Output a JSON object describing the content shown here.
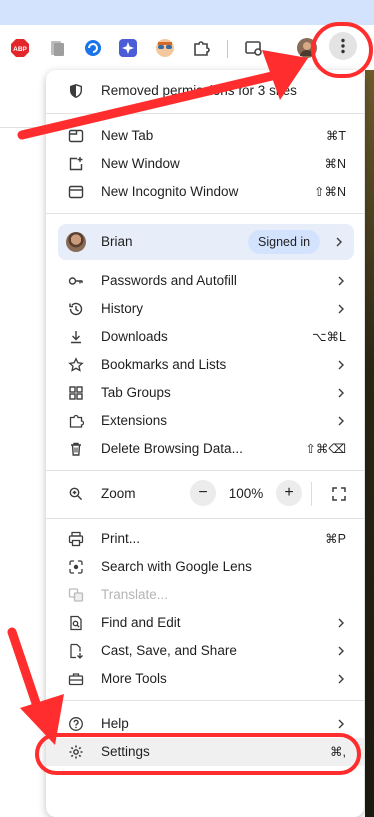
{
  "toolbar": {
    "extensions": [
      "adblock-plus-icon",
      "document-icon",
      "sync-icon",
      "sparkle-icon",
      "avatar-extension-icon",
      "puzzle-icon",
      "tab-search-icon"
    ],
    "abp_label": "ABP"
  },
  "menu": {
    "notice": "Removed permissions for 3 sites",
    "items_group1": [
      {
        "label": "New Tab",
        "shortcut": "⌘T"
      },
      {
        "label": "New Window",
        "shortcut": "⌘N"
      },
      {
        "label": "New Incognito Window",
        "shortcut": "⇧⌘N"
      }
    ],
    "profile": {
      "name": "Brian",
      "status": "Signed in"
    },
    "items_group2": [
      {
        "label": "Passwords and Autofill",
        "shortcut": ""
      },
      {
        "label": "History",
        "shortcut": ""
      },
      {
        "label": "Downloads",
        "shortcut": "⌥⌘L"
      },
      {
        "label": "Bookmarks and Lists",
        "shortcut": ""
      },
      {
        "label": "Tab Groups",
        "shortcut": ""
      },
      {
        "label": "Extensions",
        "shortcut": ""
      },
      {
        "label": "Delete Browsing Data...",
        "shortcut": "⇧⌘⌫"
      }
    ],
    "zoom": {
      "label": "Zoom",
      "value": "100%",
      "minus": "−",
      "plus": "+"
    },
    "items_group3": [
      {
        "label": "Print...",
        "shortcut": "⌘P"
      },
      {
        "label": "Search with Google Lens",
        "shortcut": ""
      },
      {
        "label": "Translate...",
        "shortcut": ""
      },
      {
        "label": "Find and Edit",
        "shortcut": ""
      },
      {
        "label": "Cast, Save, and Share",
        "shortcut": ""
      },
      {
        "label": "More Tools",
        "shortcut": ""
      }
    ],
    "items_group4": [
      {
        "label": "Help",
        "shortcut": ""
      },
      {
        "label": "Settings",
        "shortcut": "⌘,"
      }
    ]
  },
  "annotation_color": "#ff2d2d"
}
